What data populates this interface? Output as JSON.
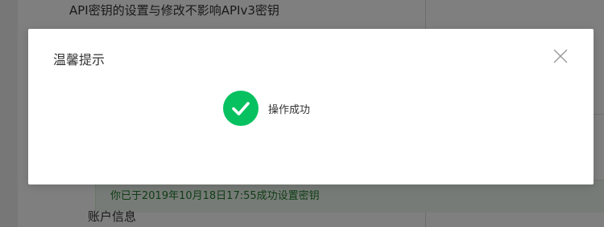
{
  "background": {
    "top_text": "API密钥的设置与修改不影响APIv3密钥",
    "notice_text": "你已于2019年10月18日17:55成功设置密钥",
    "section_title": "账户信息"
  },
  "dialog": {
    "title": "温馨提示",
    "message": "操作成功",
    "close_icon": "close-icon",
    "success_color": "#07c160"
  }
}
